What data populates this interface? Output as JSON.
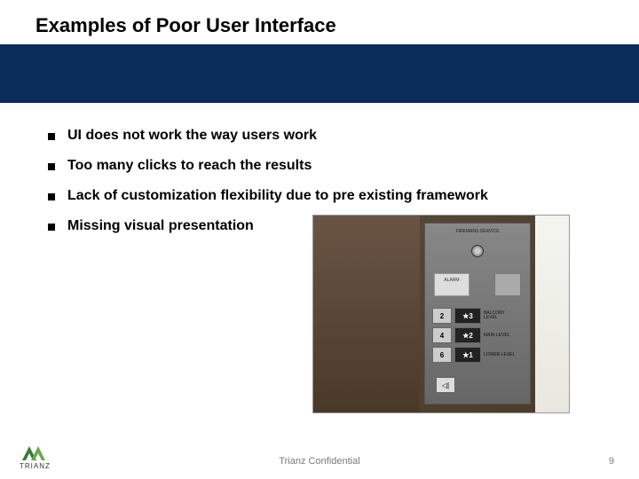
{
  "title": "Examples of Poor User Interface",
  "bullets": [
    "UI does not work the way users work",
    "Too many clicks to reach the results",
    "Lack of customization flexibility due to pre existing framework",
    "Missing visual presentation"
  ],
  "elevator_panel": {
    "top_label": "FIREMANS SERVICE",
    "mid_label": "ALARM",
    "rows": [
      {
        "light": "2",
        "dark": "★3",
        "label": "BALCONY LEVEL"
      },
      {
        "light": "4",
        "dark": "★2",
        "label": "MAIN LEVEL"
      },
      {
        "light": "6",
        "dark": "★1",
        "label": "LOWER LEVEL"
      }
    ],
    "open_symbol": "◁|"
  },
  "footer": {
    "logo_text": "TRIANZ",
    "center": "Trianz Confidential",
    "page": "9"
  }
}
